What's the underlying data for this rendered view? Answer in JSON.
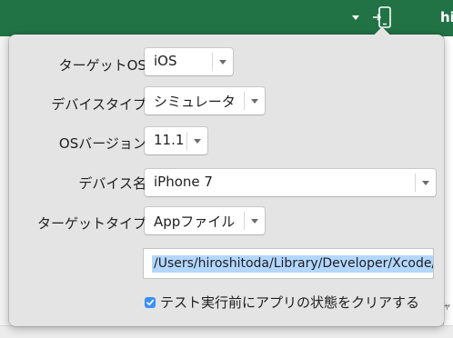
{
  "header": {
    "partial_title": "hi"
  },
  "dialog": {
    "target_os": {
      "label": "ターゲットOS:",
      "value": "iOS"
    },
    "device_type": {
      "label": "デバイスタイプ:",
      "value": "シミュレータ"
    },
    "os_version": {
      "label": "OSバージョン:",
      "value": "11.1"
    },
    "device_name": {
      "label": "デバイス名:",
      "value": "iPhone 7"
    },
    "target_type": {
      "label": "ターゲットタイプ:",
      "value": "Appファイル"
    },
    "app_path": {
      "value": "/Users/hiroshitoda/Library/Developer/Xcode/D"
    },
    "reset_checkbox": {
      "label": "テスト実行前にアプリの状態をクリアする",
      "checked": true
    }
  },
  "background": {
    "partial_glyph": "ャ"
  },
  "colors": {
    "header_green": "#217346",
    "selection": "#b3d7ff",
    "checkbox_blue": "#3b8ff7"
  },
  "icons": [
    "dropdown-caret-icon",
    "device-icon"
  ]
}
